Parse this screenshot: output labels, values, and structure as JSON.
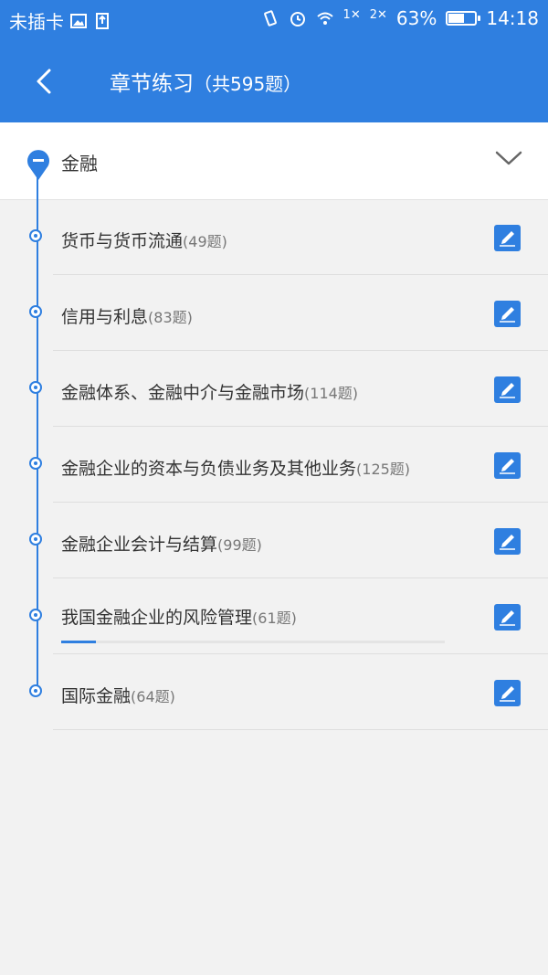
{
  "status_bar": {
    "carrier": "未插卡",
    "sim1": "1",
    "sim2": "2",
    "battery_percent": "63%",
    "battery_level": 0.63,
    "time": "14:18"
  },
  "header": {
    "title": "章节练习",
    "count": "（共595题）",
    "back_icon": "chevron-left-icon"
  },
  "group": {
    "label": "金融",
    "expand_icon": "chevron-down-icon"
  },
  "chapters": [
    {
      "name": "货币与货币流通",
      "count": "(49题)"
    },
    {
      "name": "信用与利息",
      "count": "(83题)"
    },
    {
      "name": "金融体系、金融中介与金融市场",
      "count": "(114题)"
    },
    {
      "name": "金融企业的资本与负债业务及其他业务",
      "count": "(125题)"
    },
    {
      "name": "金融企业会计与结算",
      "count": "(99题)"
    },
    {
      "name": "我国金融企业的风险管理",
      "count": "(61题)",
      "progress": 0.09
    },
    {
      "name": "国际金融",
      "count": "(64题)"
    }
  ],
  "colors": {
    "accent": "#2f7fe0",
    "background": "#f2f2f2",
    "text": "#333333",
    "muted": "#777777"
  }
}
